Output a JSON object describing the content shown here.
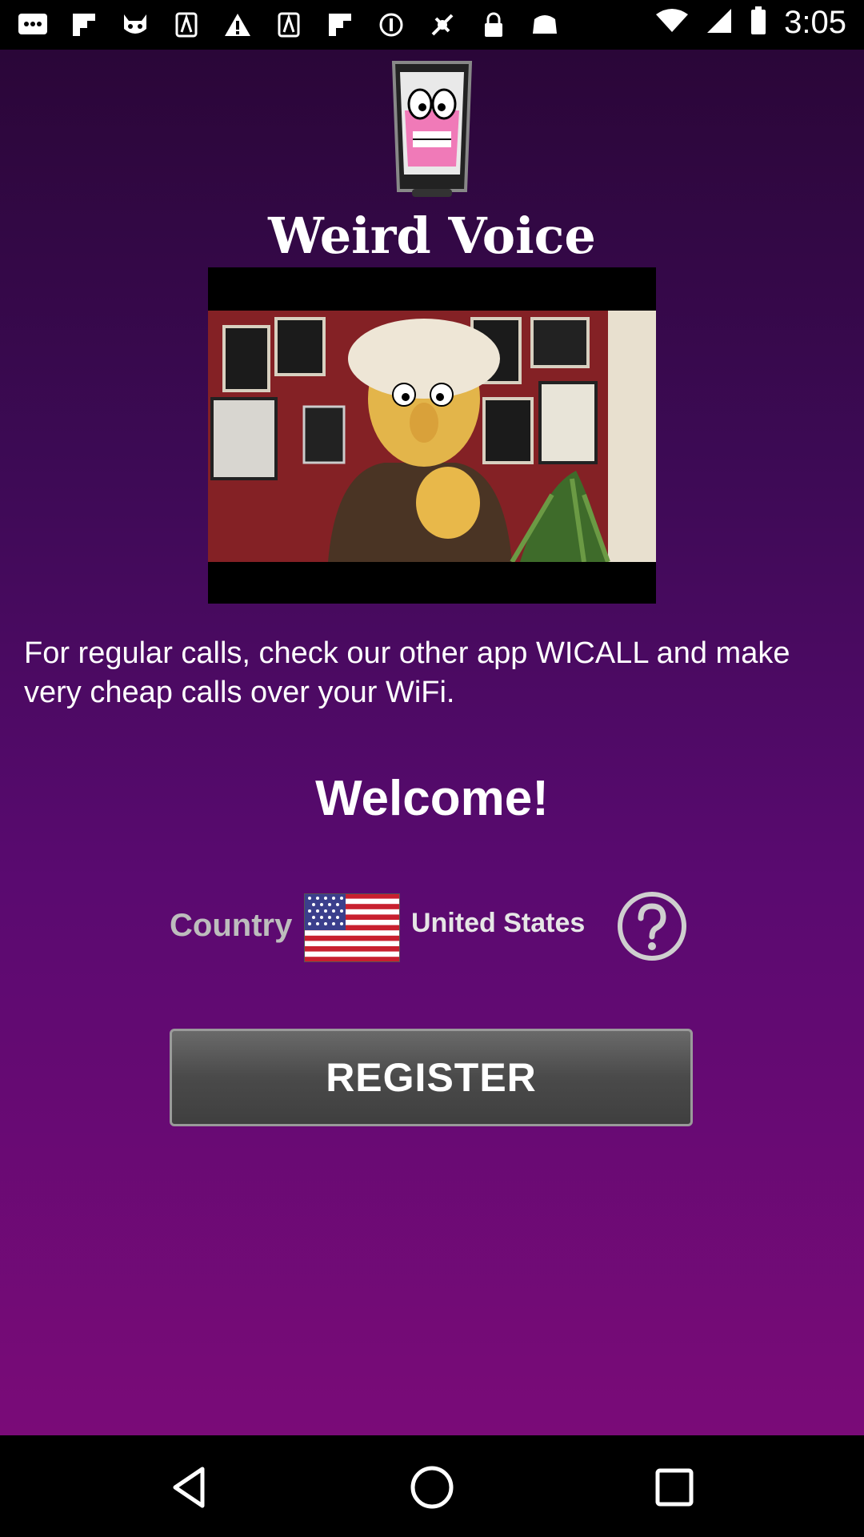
{
  "status_bar": {
    "time": "3:05",
    "icons": [
      "message-icon",
      "flipboard-icon",
      "cat-icon",
      "puzzle-icon",
      "warning-icon",
      "puzzle-icon",
      "flipboard-icon",
      "circle-icon",
      "fake-gps-icon",
      "lock-icon",
      "game-icon"
    ]
  },
  "app": {
    "title": "Weird Voice",
    "promo_text": "For regular calls, check our other app WICALL and make very cheap calls over your WiFi.",
    "welcome": "Welcome!",
    "country_label": "Country",
    "country_name": "United States",
    "register_label": "REGISTER"
  },
  "colors": {
    "background_top": "#2a0638",
    "background_bottom": "#7a0b78",
    "button": "#4a4a4a"
  }
}
